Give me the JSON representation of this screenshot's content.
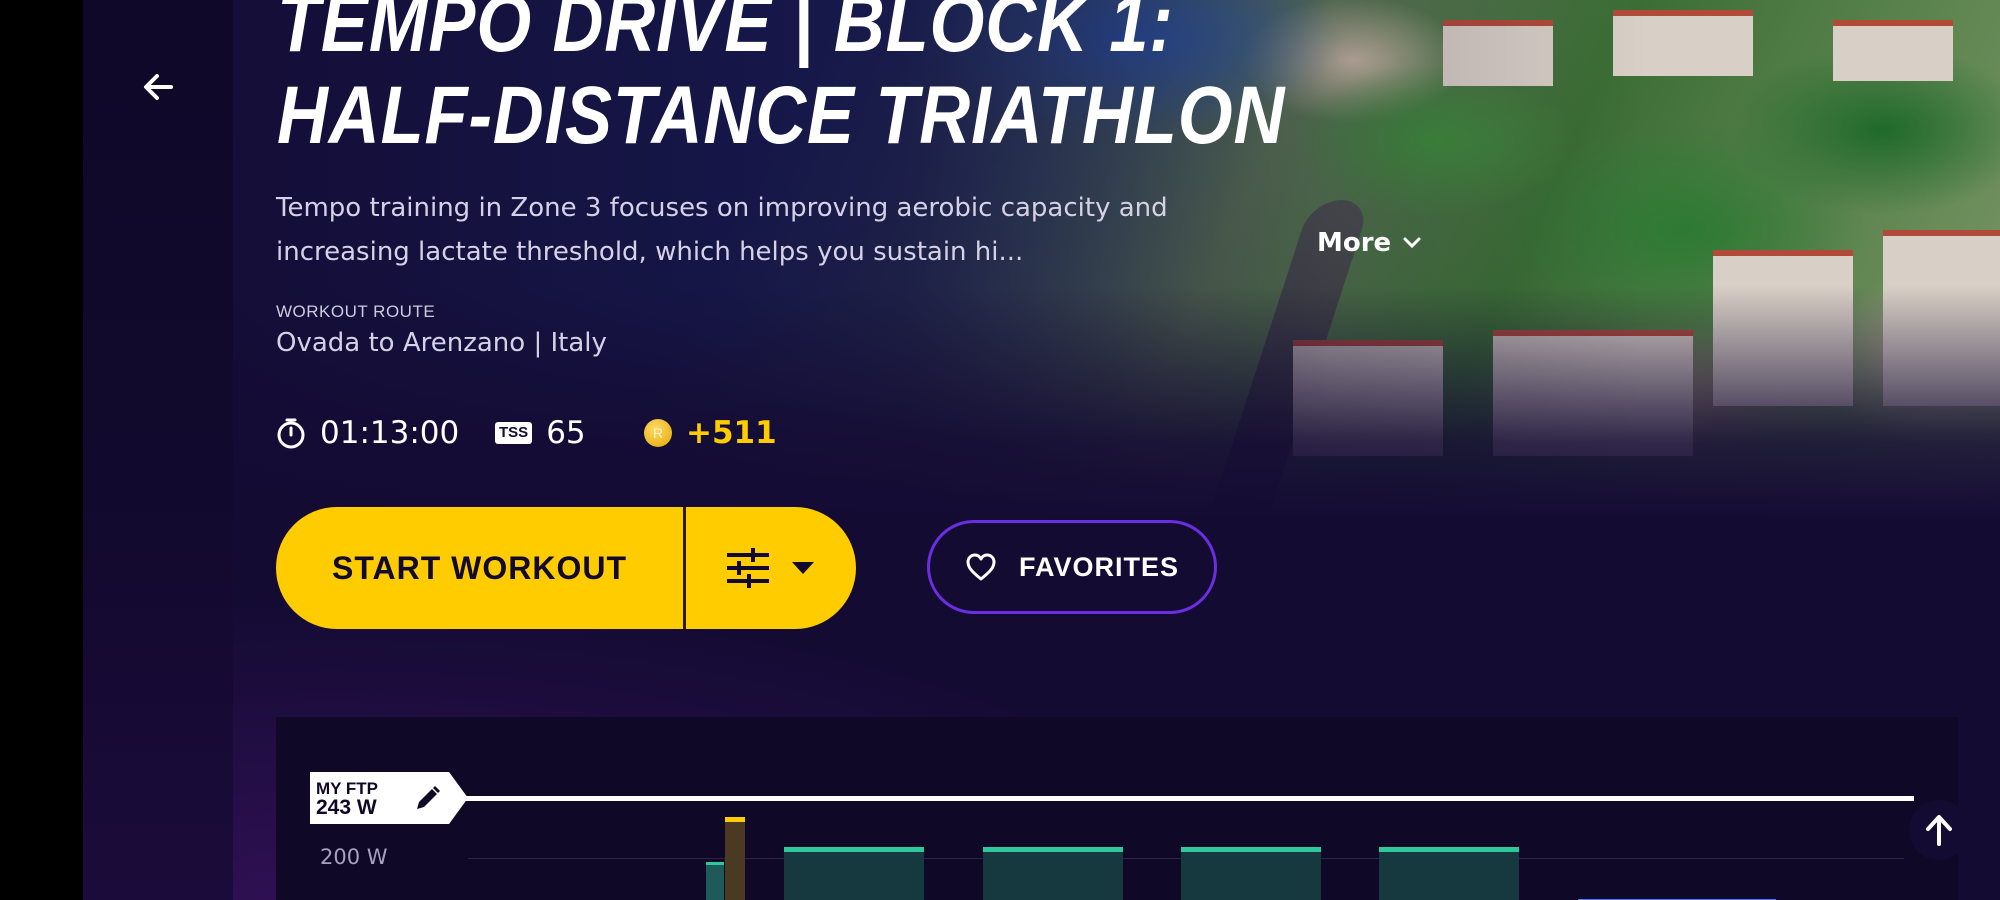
{
  "workout": {
    "title_line1": "TEMPO DRIVE | BLOCK 1:",
    "title_line2": "HALF-DISTANCE TRIATHLON",
    "description_line1": "Tempo training in Zone 3 focuses on improving aerobic capacity and",
    "description_line2": "increasing lactate threshold, which helps you sustain hi...",
    "more_label": "More",
    "route_label": "WORKOUT ROUTE",
    "route_value": "Ovada to Arenzano | Italy"
  },
  "stats": {
    "duration": "01:13:00",
    "tss_badge": "TSS",
    "tss_value": "65",
    "coin_glyph": "R",
    "coins_value": "+511"
  },
  "actions": {
    "start_label": "START WORKOUT",
    "favorites_label": "FAVORITES"
  },
  "chart": {
    "ftp_label": "MY FTP",
    "ftp_value": "243 W",
    "y_tick_label": "200 W"
  },
  "colors": {
    "accent_yellow": "#ffcc00",
    "favorites_border": "#6b2ee0",
    "interval_green": "#2ec99a",
    "background": "#140b33"
  },
  "icons": {
    "back": "arrow-left-icon",
    "more": "chevron-down-icon",
    "duration": "stopwatch-icon",
    "coins": "coin-icon",
    "options": "sliders-icon",
    "options_caret": "caret-down-icon",
    "favorite": "heart-icon",
    "edit": "pencil-icon",
    "scroll_top": "arrow-up-icon"
  }
}
